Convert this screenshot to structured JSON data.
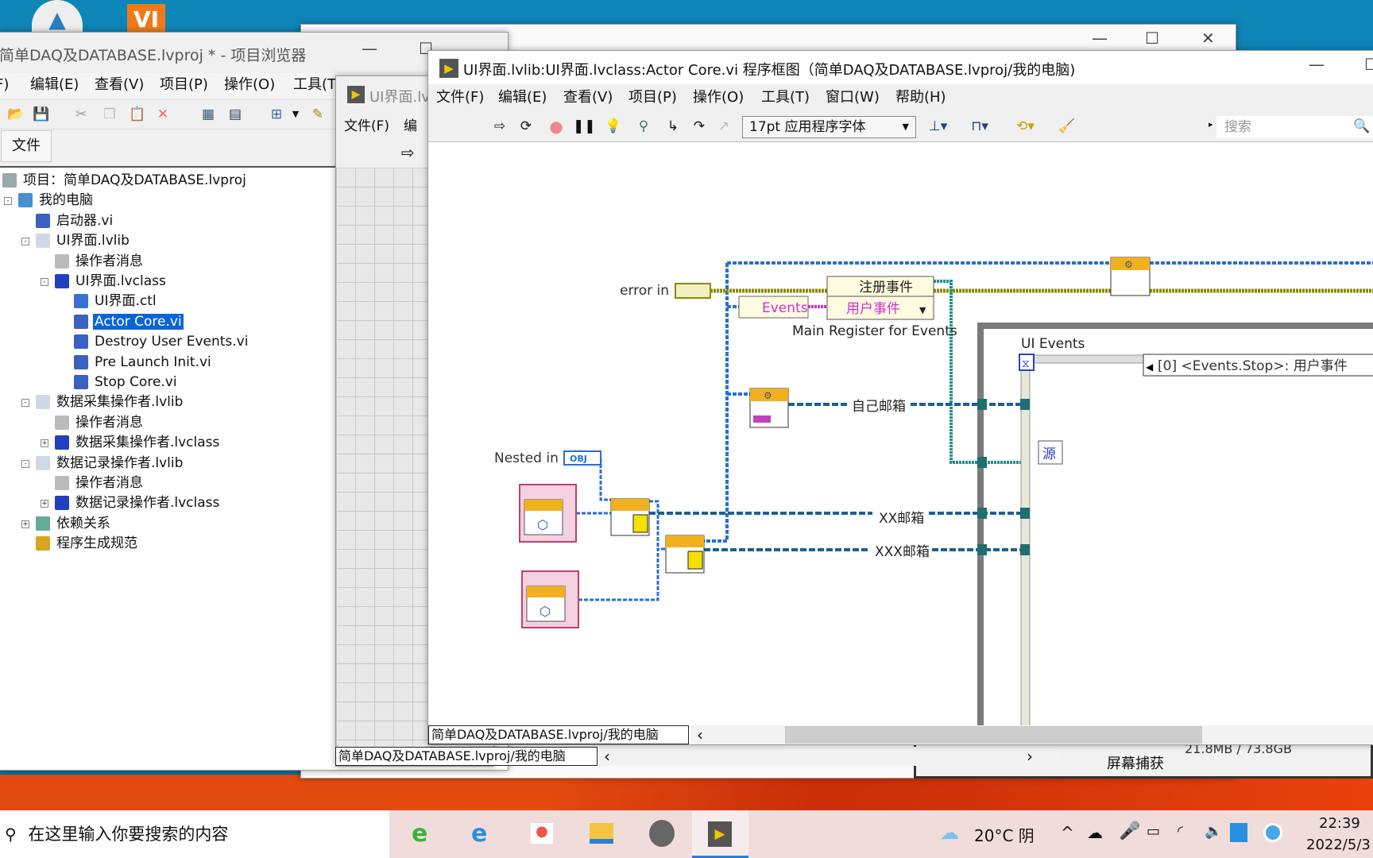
{
  "desktop": {
    "icons": [
      "app-icon-a",
      "vi-icon"
    ],
    "vi_icon_text": "VI"
  },
  "bg_window": {
    "buttons": {
      "min": "—",
      "max": "☐",
      "close": "✕"
    }
  },
  "explorer": {
    "title": "简单DAQ及DATABASE.lvproj * - 项目浏览器",
    "menu": [
      "文件(F)",
      "编辑(E)",
      "查看(V)",
      "项目(P)",
      "操作(O)",
      "工具(T)"
    ],
    "tab": "文件",
    "tree": [
      {
        "label": "项目：简单DAQ及DATABASE.lvproj",
        "level": 0,
        "icon": "project-icon"
      },
      {
        "label": "我的电脑",
        "level": 1,
        "icon": "computer-icon",
        "toggle": "-"
      },
      {
        "label": "启动器.vi",
        "level": 2,
        "icon": "vi-icon"
      },
      {
        "label": "UI界面.lvlib",
        "level": 2,
        "icon": "library-icon",
        "toggle": "-"
      },
      {
        "label": "操作者消息",
        "level": 3,
        "icon": "folder-icon"
      },
      {
        "label": "UI界面.lvclass",
        "level": 3,
        "icon": "class-icon",
        "toggle": "-"
      },
      {
        "label": "UI界面.ctl",
        "level": 4,
        "icon": "control-icon"
      },
      {
        "label": "Actor Core.vi",
        "level": 4,
        "icon": "vi-icon",
        "selected": true
      },
      {
        "label": "Destroy User Events.vi",
        "level": 4,
        "icon": "vi-icon"
      },
      {
        "label": "Pre Launch Init.vi",
        "level": 4,
        "icon": "vi-icon"
      },
      {
        "label": "Stop Core.vi",
        "level": 4,
        "icon": "vi-icon"
      },
      {
        "label": "数据采集操作者.lvlib",
        "level": 2,
        "icon": "library-icon",
        "toggle": "-"
      },
      {
        "label": "操作者消息",
        "level": 3,
        "icon": "folder-icon"
      },
      {
        "label": "数据采集操作者.lvclass",
        "level": 3,
        "icon": "class-icon",
        "toggle": "+"
      },
      {
        "label": "数据记录操作者.lvlib",
        "level": 2,
        "icon": "library-icon",
        "toggle": "-"
      },
      {
        "label": "操作者消息",
        "level": 3,
        "icon": "folder-icon"
      },
      {
        "label": "数据记录操作者.lvclass",
        "level": 3,
        "icon": "class-icon",
        "toggle": "+"
      },
      {
        "label": "依赖关系",
        "level": 2,
        "icon": "dependencies-icon",
        "toggle": "+"
      },
      {
        "label": "程序生成规范",
        "level": 2,
        "icon": "build-spec-icon"
      }
    ]
  },
  "front_panel": {
    "title": "UI界面.lv",
    "menu_file": "文件(F)",
    "menu_edit": "编",
    "status": "简单DAQ及DATABASE.lvproj/我的电脑",
    "scroll_left": "‹",
    "scroll_right": "›"
  },
  "main": {
    "title": "UI界面.lvlib:UI界面.lvclass:Actor Core.vi 程序框图（简单DAQ及DATABASE.lvproj/我的电脑)",
    "menu": [
      "文件(F)",
      "编辑(E)",
      "查看(V)",
      "项目(P)",
      "操作(O)",
      "工具(T)",
      "窗口(W)",
      "帮助(H)"
    ],
    "font_select": "17pt 应用程序字体",
    "search_placeholder": "搜索",
    "status": "简单DAQ及DATABASE.lvproj/我的电脑",
    "scroll_left": "‹",
    "diagram": {
      "error_in": "error in",
      "register_title": "注册事件",
      "register_input": "用户事件",
      "events_const": "Events",
      "register_label": "Main Register for Events",
      "event_structure_label": "UI Events",
      "event_case": "[0] <Events.Stop>: 用户事件",
      "self_mailbox": "自己邮箱",
      "nested_in": "Nested in",
      "obj_tag": "OBJ",
      "xx_mailbox": "XX邮箱",
      "xxx_mailbox": "XXX邮箱",
      "source_node": "源",
      "colors": {
        "error_wire": "#8a8a00",
        "class_wire": "#2a6fd0",
        "queue_wire": "#1f5f8f",
        "event_wire": "#1f8f8f",
        "frame": "#7a7a7a"
      }
    }
  },
  "bg_capture": {
    "label": "屏幕捕获",
    "storage": "21.8MB / 73.8GB"
  },
  "taskbar": {
    "search_placeholder": "在这里输入你要搜索的内容",
    "apps": [
      "ie-green-icon",
      "ie-icon",
      "media-icon",
      "file-explorer-icon",
      "avatar",
      "labview-icon"
    ],
    "weather": "20°C 阴",
    "time": "22:39",
    "date": "2022/5/3"
  }
}
